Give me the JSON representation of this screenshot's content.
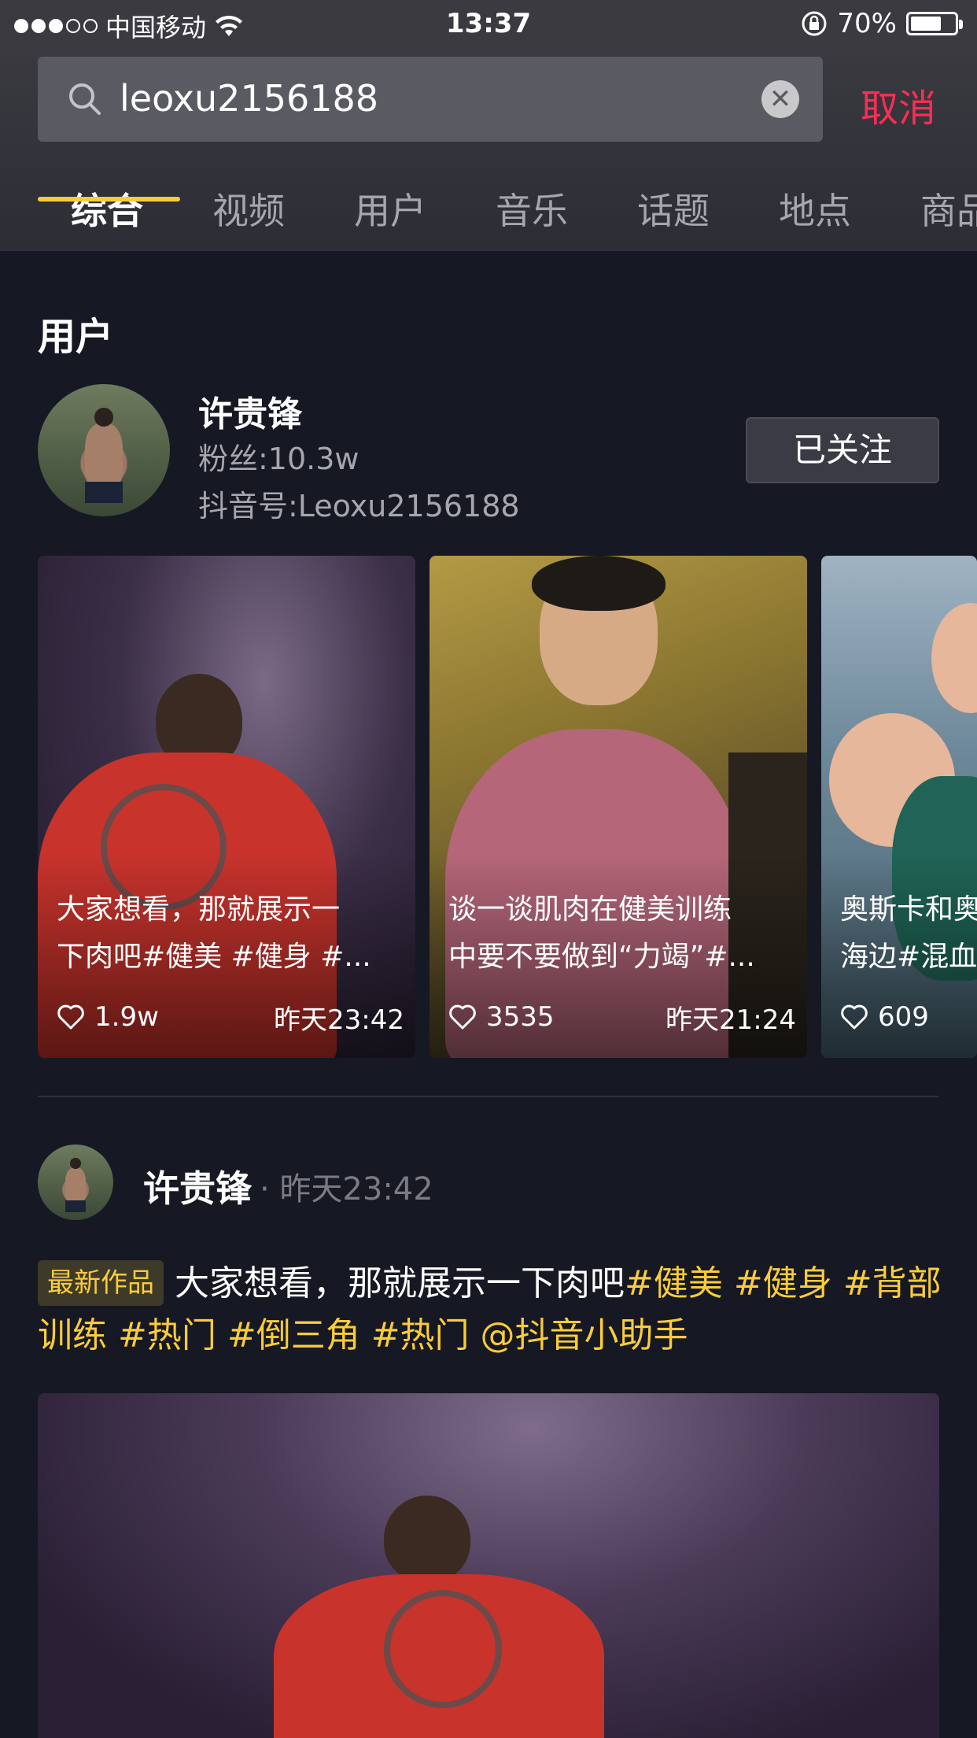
{
  "status_bar": {
    "carrier": "中国移动",
    "time": "13:37",
    "battery": "70%",
    "battery_level": 0.7
  },
  "search": {
    "query": "leoxu2156188",
    "cancel_label": "取消"
  },
  "tabs": [
    "综合",
    "视频",
    "用户",
    "音乐",
    "话题",
    "地点",
    "商品"
  ],
  "active_tab": "综合",
  "user_section": {
    "title": "用户",
    "name": "许贵锋",
    "fans": "粉丝:10.3w",
    "douyin_id": "抖音号:Leoxu2156188",
    "follow_label": "已关注"
  },
  "videos": [
    {
      "title_line1": "大家想看，那就展示一",
      "title_line2": "下肉吧#健美 #健身 #...",
      "likes": "1.9w",
      "time": "昨天23:42"
    },
    {
      "title_line1": "谈一谈肌肉在健美训练",
      "title_line2": "中要不要做到“力竭”#...",
      "likes": "3535",
      "time": "昨天21:24"
    },
    {
      "title_line1": "奥斯卡和奥",
      "title_line2": "海边#混血",
      "likes": "609",
      "time": ""
    }
  ],
  "post": {
    "author": "许贵锋",
    "time": "· 昨天23:42",
    "badge": "最新作品",
    "text_plain": "大家想看，那就展示一下肉吧",
    "text_tags": "#健美 #健身 #背部训练 #热门 #倒三角 #热门 @抖音小助手"
  },
  "colors": {
    "background": "#161823",
    "accent_yellow": "#facc3a",
    "cancel_red": "#fe2c55"
  }
}
